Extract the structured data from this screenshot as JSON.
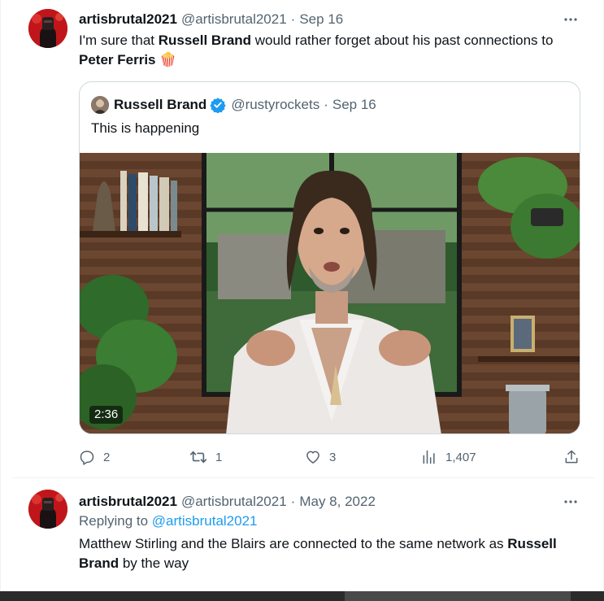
{
  "tweets": [
    {
      "author": {
        "name": "artisbrutal2021",
        "handle": "@artisbrutal2021",
        "avatar_icon": "red-masked-figure-avatar"
      },
      "date": "Sep 16",
      "text": {
        "part1": "I'm sure that ",
        "bold1": "Russell Brand",
        "part2": " would rather forget about his past connections to ",
        "bold2": "Peter Ferris",
        "emoji": "🍿"
      },
      "quote": {
        "author_name": "Russell Brand",
        "author_handle": "@rustyrockets",
        "date": "Sep 16",
        "verified": true,
        "text": "This is happening",
        "video_duration": "2:36"
      },
      "actions": {
        "replies": "2",
        "retweets": "1",
        "likes": "3",
        "views": "1,407"
      }
    },
    {
      "author": {
        "name": "artisbrutal2021",
        "handle": "@artisbrutal2021",
        "avatar_icon": "red-masked-figure-avatar"
      },
      "date": "May 8, 2022",
      "replying_label": "Replying to ",
      "replying_handle": "@artisbrutal2021",
      "text": {
        "part1": "Matthew Stirling and the Blairs are connected to the same network as ",
        "bold1": "Russell Brand",
        "part2": " by the way"
      }
    }
  ],
  "separator": "·",
  "colors": {
    "accent": "#1d9bf0",
    "text_primary": "#0f1419",
    "text_secondary": "#536471",
    "border": "#cfd9de",
    "avatar_red": "#c0161b"
  }
}
